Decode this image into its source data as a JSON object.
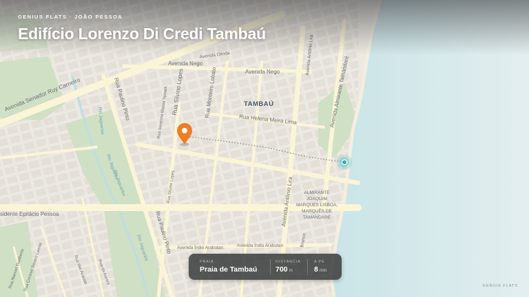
{
  "header": {
    "eyebrow": "GENIUS FLATS · JOÃO PESSOA",
    "title": "Edifício Lorenzo Di Credi Tambaú"
  },
  "map": {
    "neighborhood": "TAMBAÚ",
    "streets": {
      "senador_ruy_carneiro": "Avenida Senador Ruy Carneiro",
      "nego_upper": "Avenida Nego",
      "nego_main": "Avenida Nego",
      "olinda": "Avenida Olinda",
      "antonio_lira_upper": "Avenida Antônio Lira",
      "almirante_tamandare": "Avenida Almirante Tamandaré",
      "paulino_pinto_upper": "Rua Paulino Pinto",
      "paulino_pinto_lower": "Rua Paulino Pinto",
      "severino_massa": "Rua Severino Massa Spinelli",
      "silvino_lopes_upper": "Rua Silvino Lopes",
      "silvino_lopes_lower": "Rua Silvino Lopes",
      "monteiro_lobato": "Rua Monteiro Lobato",
      "helena_meira": "Rua Helena Meira Lima",
      "antonio_lira_lower": "Avenida Antônio Lira",
      "epitacio": "sidente Epitácio Pessoa",
      "indio_1": "Avenida Índio Arabutan",
      "indio_2": "Avenida Índio Arabutan",
      "jaguaribe_1": "Rio Jaguaribe",
      "jaguaribe_2": "Rio Jaguaribe",
      "jaguaribe_3": "Rio Jaguaribe",
      "jaguaribe_4": "Rio Jaguaribe",
      "manoel": "Rua Manoel Gualberto",
      "coronel": "Rua Coronel Severo Lemos",
      "acacias": "Rua das Acácias",
      "aurora": "Rua da Aurora",
      "branco": "Branco"
    },
    "poi_label": [
      "ALMIRANTE",
      "JOAQUIM",
      "MARQUES LISBOA,",
      "MARQUÊS DE",
      "TAMANDARÉ"
    ],
    "colors": {
      "land": "#ece9e2",
      "park": "#cfe0c4",
      "ocean": "#c7e3e6",
      "road": "#fbf5d8",
      "pin": "#f07d22",
      "beach_marker": "#4bbfd1"
    }
  },
  "info_card": {
    "destination_label": "PRAIA",
    "destination": "Praia de Tambaú",
    "distance_label": "DISTÂNCIA",
    "distance_value": "700",
    "distance_unit": "m",
    "walk_label": "A PÉ",
    "walk_value": "8",
    "walk_unit": "min"
  },
  "footer": "GENIUS FLATS"
}
